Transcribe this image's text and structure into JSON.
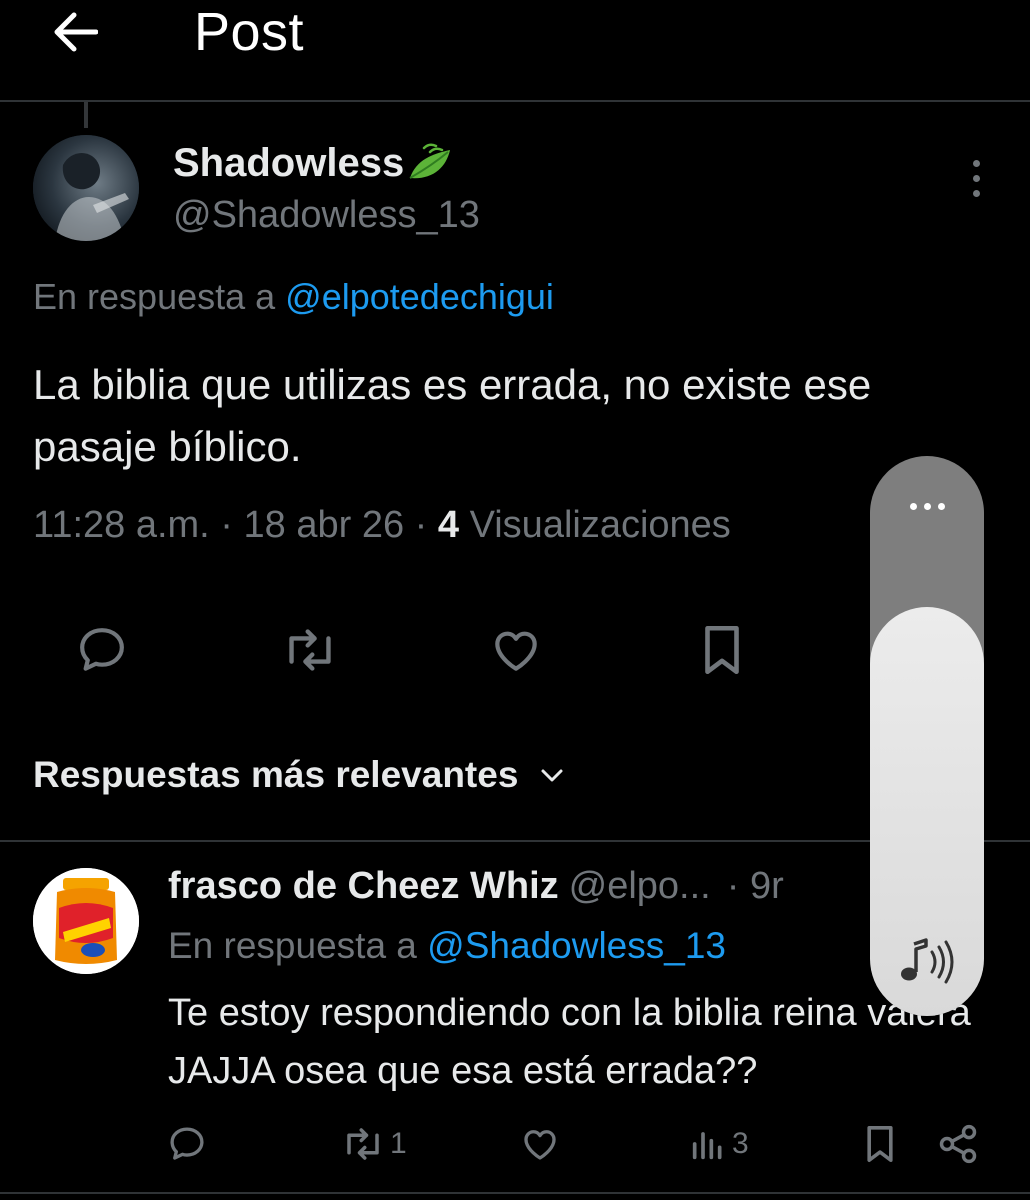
{
  "header": {
    "title": "Post",
    "back_icon": "arrow-left-icon"
  },
  "main_post": {
    "author_name": "Shadowless",
    "author_emoji": "herb-leaf-icon",
    "author_handle": "@Shadowless_13",
    "reply_prefix": "En respuesta a",
    "reply_handle": "@elpotedechigui",
    "text": "La biblia que utilizas es errada, no existe ese pasaje bíblico.",
    "time": "11:28 a.m.",
    "date": "18 abr 26",
    "separator": "·",
    "views_count": "4",
    "views_label": "Visualizaciones",
    "actions": [
      "reply-icon",
      "repost-icon",
      "like-icon",
      "bookmark-icon"
    ]
  },
  "replies_sort": {
    "label": "Respuestas más relevantes"
  },
  "reply": {
    "author_name": "frasco de Cheez Whiz",
    "author_handle": "@elpo...",
    "time_fragment": "· 9r",
    "reply_prefix": "En respuesta a",
    "reply_handle": "@Shadowless_13",
    "text": "Te estoy respondiendo con la biblia reina valera JAJJA osea que esa está errada??",
    "repost_count": "1",
    "views_count": "3",
    "actions": [
      "reply-icon",
      "repost-icon",
      "like-icon",
      "views-icon",
      "bookmark-icon",
      "share-icon"
    ]
  },
  "volume_overlay": {
    "level": 0.73,
    "icon": "music-volume-icon"
  },
  "colors": {
    "background": "#000000",
    "text": "#e7e9ea",
    "muted": "#71767b",
    "link": "#1d9bf0",
    "divider": "#2f3336"
  }
}
